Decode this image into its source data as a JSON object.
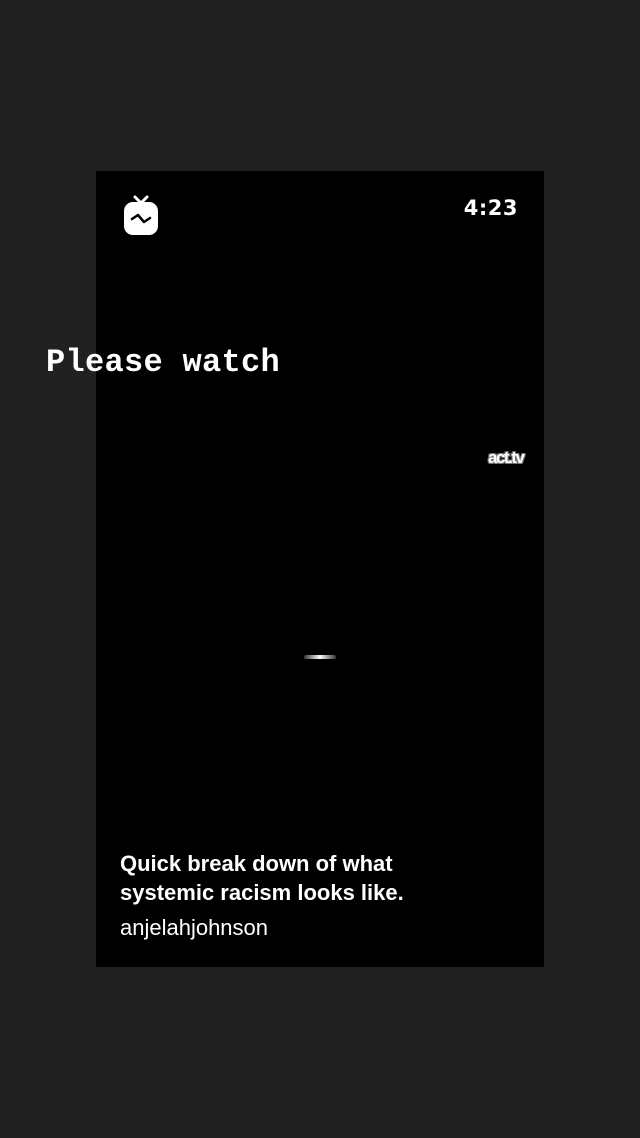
{
  "story": {
    "overlay_text": "Please watch",
    "background_color": "#212121"
  },
  "video": {
    "app_icon": "igtv-icon",
    "duration": "4:23",
    "watermark": "act.tv",
    "caption_line1": "Quick break down of what",
    "caption_line2": "systemic racism looks like.",
    "username": "anjelahjohnson"
  }
}
